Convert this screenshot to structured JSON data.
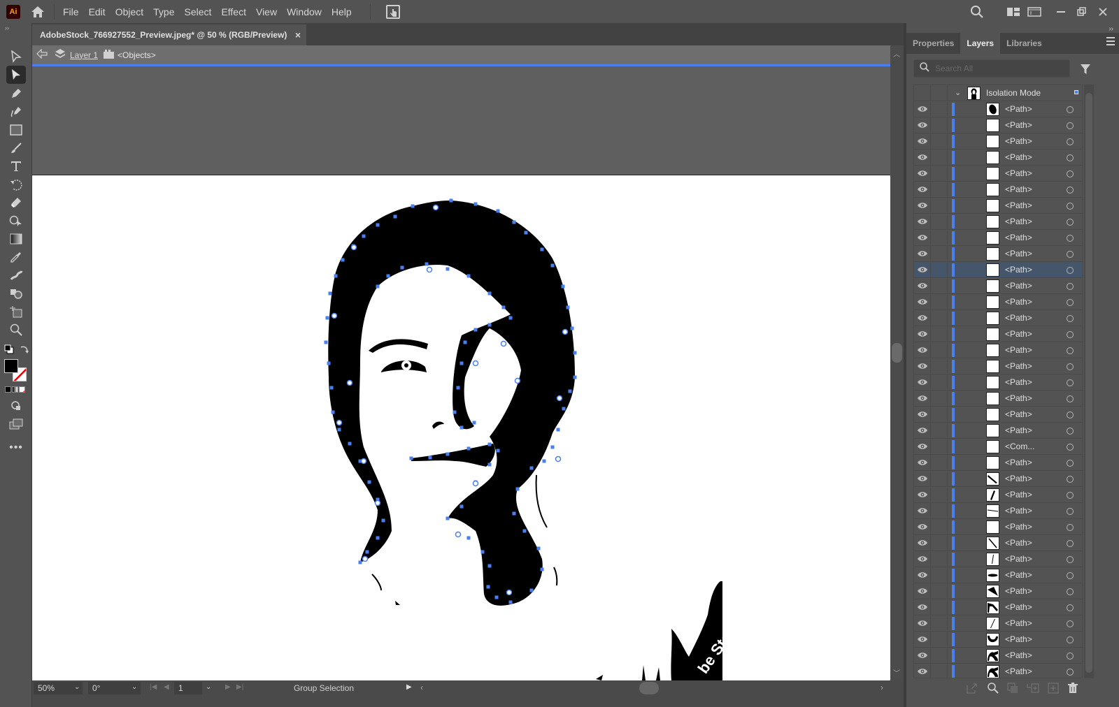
{
  "app": {
    "logo": "Ai",
    "menu": [
      "File",
      "Edit",
      "Object",
      "Type",
      "Select",
      "Effect",
      "View",
      "Window",
      "Help"
    ]
  },
  "document": {
    "tab_title": "AdobeStock_766927552_Preview.jpeg* @ 50 % (RGB/Preview)",
    "close_glyph": "×"
  },
  "isolation": {
    "layer": "Layer 1",
    "group": "<Objects>"
  },
  "artwork": {
    "watermark_text": "be Sto"
  },
  "statusbar": {
    "zoom": "50%",
    "rotation": "0°",
    "artboard_number": "1",
    "tool_status": "Group Selection"
  },
  "panel": {
    "tabs": [
      "Properties",
      "Layers",
      "Libraries"
    ],
    "active_tab": "Layers",
    "search_placeholder": "Search All",
    "root_label": "Isolation Mode",
    "rows": [
      {
        "name": "<Path>",
        "thumb": "blob"
      },
      {
        "name": "<Path>",
        "thumb": "blank"
      },
      {
        "name": "<Path>",
        "thumb": "blank"
      },
      {
        "name": "<Path>",
        "thumb": "blank"
      },
      {
        "name": "<Path>",
        "thumb": "blank"
      },
      {
        "name": "<Path>",
        "thumb": "blank"
      },
      {
        "name": "<Path>",
        "thumb": "blank"
      },
      {
        "name": "<Path>",
        "thumb": "blank"
      },
      {
        "name": "<Path>",
        "thumb": "blank"
      },
      {
        "name": "<Path>",
        "thumb": "blank"
      },
      {
        "name": "<Path>",
        "thumb": "blank",
        "selected": true
      },
      {
        "name": "<Path>",
        "thumb": "blank"
      },
      {
        "name": "<Path>",
        "thumb": "blank"
      },
      {
        "name": "<Path>",
        "thumb": "blank"
      },
      {
        "name": "<Path>",
        "thumb": "blank"
      },
      {
        "name": "<Path>",
        "thumb": "blank"
      },
      {
        "name": "<Path>",
        "thumb": "blank"
      },
      {
        "name": "<Path>",
        "thumb": "blank"
      },
      {
        "name": "<Path>",
        "thumb": "blank"
      },
      {
        "name": "<Path>",
        "thumb": "blank"
      },
      {
        "name": "<Path>",
        "thumb": "blank"
      },
      {
        "name": "<Com...",
        "thumb": "blank"
      },
      {
        "name": "<Path>",
        "thumb": "blank"
      },
      {
        "name": "<Path>",
        "thumb": "diag-stroke"
      },
      {
        "name": "<Path>",
        "thumb": "slash"
      },
      {
        "name": "<Path>",
        "thumb": "thin-line"
      },
      {
        "name": "<Path>",
        "thumb": "blank"
      },
      {
        "name": "<Path>",
        "thumb": "diag-thin"
      },
      {
        "name": "<Path>",
        "thumb": "vertical"
      },
      {
        "name": "<Path>",
        "thumb": "horizontal"
      },
      {
        "name": "<Path>",
        "thumb": "wedge"
      },
      {
        "name": "<Path>",
        "thumb": "hook"
      },
      {
        "name": "<Path>",
        "thumb": "slash-thin"
      },
      {
        "name": "<Path>",
        "thumb": "cup"
      },
      {
        "name": "<Path>",
        "thumb": "wave"
      },
      {
        "name": "<Path>",
        "thumb": "wave"
      }
    ]
  },
  "colors": {
    "accent": "#4a7ff0",
    "selected_row": "#46566a",
    "ui_bg": "#535353"
  }
}
